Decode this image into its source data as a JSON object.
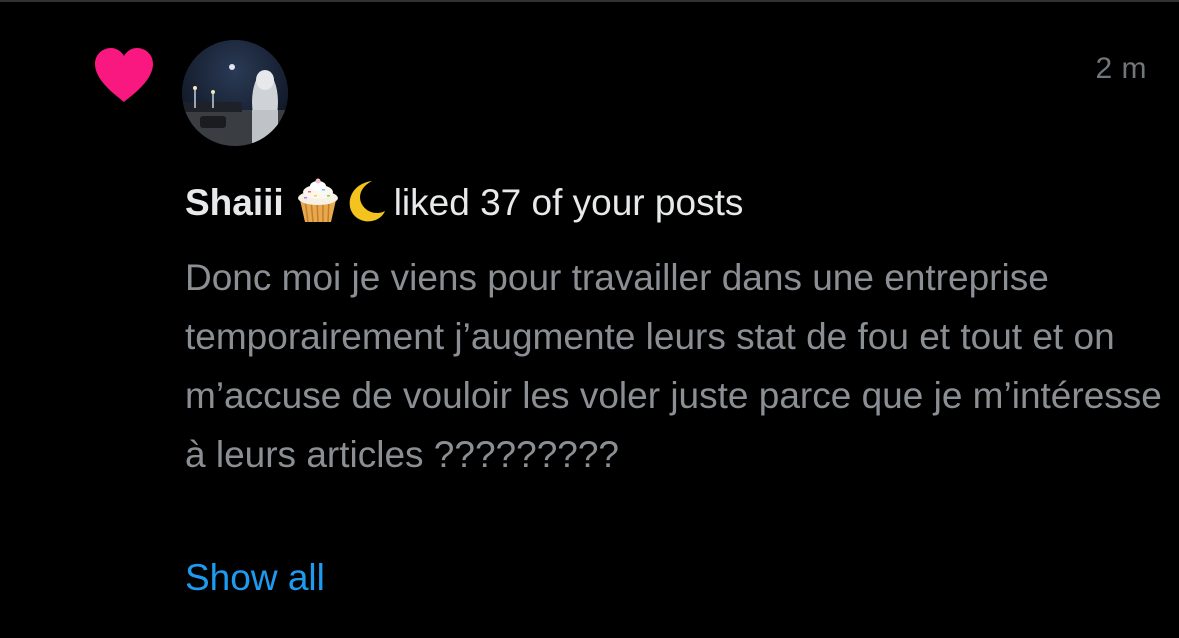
{
  "notification": {
    "timestamp": "2 m",
    "user": {
      "display_name": "Shaiii",
      "emojis": [
        "cupcake-icon",
        "crescent-moon-icon"
      ]
    },
    "action_text": "liked 37 of your posts",
    "post_text": "Donc moi je viens pour travailler dans une entreprise temporairement j’augmente leurs stat de fou et tout et on m’accuse de vouloir les voler juste parce que je m’intéresse à leurs articles ?????????",
    "show_all_label": "Show all"
  },
  "colors": {
    "background": "#000000",
    "heart": "#f91880",
    "primary_text": "#e7e9ea",
    "secondary_text": "#8b8f94",
    "timestamp": "#71767b",
    "link": "#1d9bf0"
  }
}
